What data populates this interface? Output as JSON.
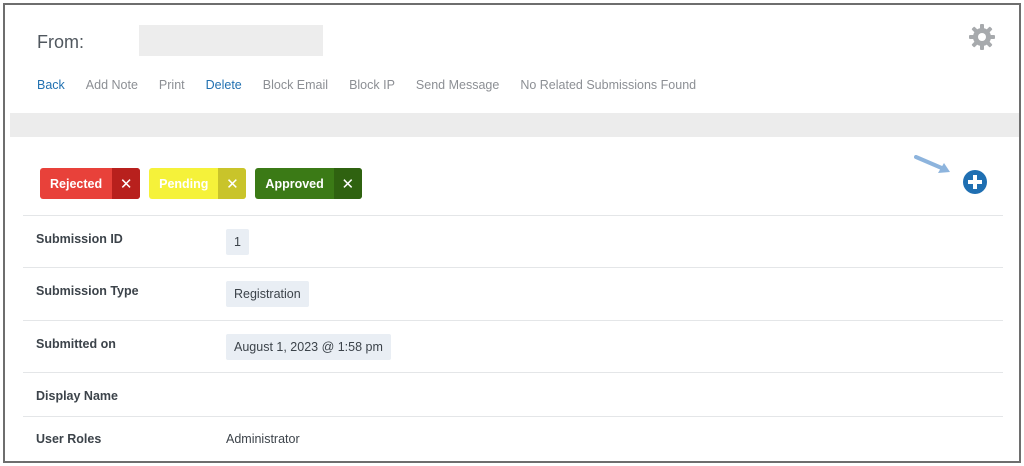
{
  "header": {
    "from_label": "From:",
    "from_value": "",
    "settings_icon": "gear-icon"
  },
  "actions": [
    {
      "label": "Back",
      "active": true
    },
    {
      "label": "Add Note",
      "active": false
    },
    {
      "label": "Print",
      "active": false
    },
    {
      "label": "Delete",
      "active": true
    },
    {
      "label": "Block Email",
      "active": false
    },
    {
      "label": "Block IP",
      "active": false
    },
    {
      "label": "Send Message",
      "active": false
    },
    {
      "label": "No Related Submissions Found",
      "active": false
    }
  ],
  "tags": [
    {
      "label": "Rejected",
      "color": "#e8413a",
      "x_color": "#b8201d",
      "remove": "✕"
    },
    {
      "label": "Pending",
      "color": "#f5f23a",
      "x_color": "#c9c42a",
      "remove": "✕"
    },
    {
      "label": "Approved",
      "color": "#3b7a16",
      "x_color": "#2f6210",
      "remove": "✕"
    }
  ],
  "add_icon": "plus-circle-icon",
  "arrow_icon": "arrow-icon",
  "details": [
    {
      "label": "Submission ID",
      "value": "1"
    },
    {
      "label": "Submission Type",
      "value": "Registration"
    },
    {
      "label": "Submitted on",
      "value": "August 1, 2023 @ 1:58 pm"
    },
    {
      "label": "Display Name",
      "value": ""
    },
    {
      "label": "User Roles",
      "value": "Administrator"
    }
  ],
  "colors": {
    "link": "#2271b1",
    "muted_link": "#8c8f94",
    "add_button": "#1f6fb2",
    "arrow": "#8db4dd"
  }
}
